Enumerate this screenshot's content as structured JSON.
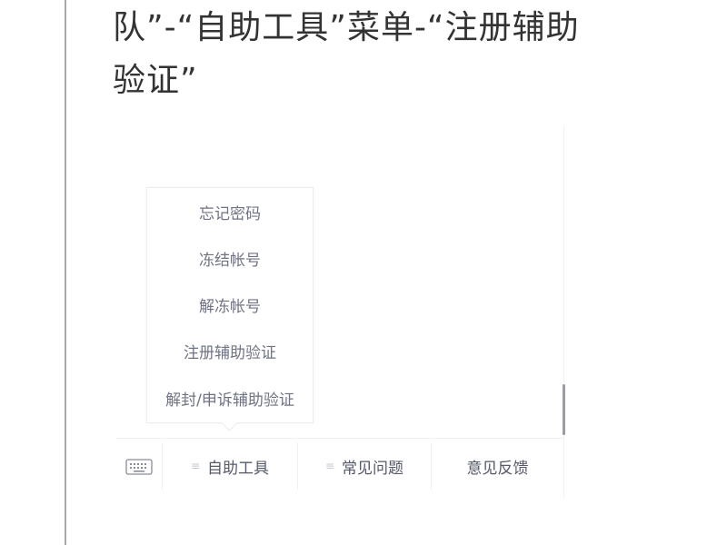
{
  "article": {
    "heading_line1": "队”-“自助工具”菜单-“注册辅助",
    "heading_line2": "验证”"
  },
  "popup_menu": {
    "items": [
      {
        "label": "忘记密码"
      },
      {
        "label": "冻结帐号"
      },
      {
        "label": "解冻帐号"
      },
      {
        "label": "注册辅助验证"
      },
      {
        "label": "解封/申诉辅助验证"
      }
    ]
  },
  "bottom_bar": {
    "keyboard_icon": "keyboard-icon",
    "tabs": [
      {
        "label": "自助工具",
        "icon": "menu-lines-icon"
      },
      {
        "label": "常见问题",
        "icon": "menu-lines-icon"
      },
      {
        "label": "意见反馈"
      }
    ]
  },
  "colors": {
    "heading_text": "#333333",
    "menu_text": "#6f7384",
    "tab_text": "#55596a",
    "scroll_thumb": "#9a9aa8",
    "left_rule": "#a9a9a9"
  }
}
